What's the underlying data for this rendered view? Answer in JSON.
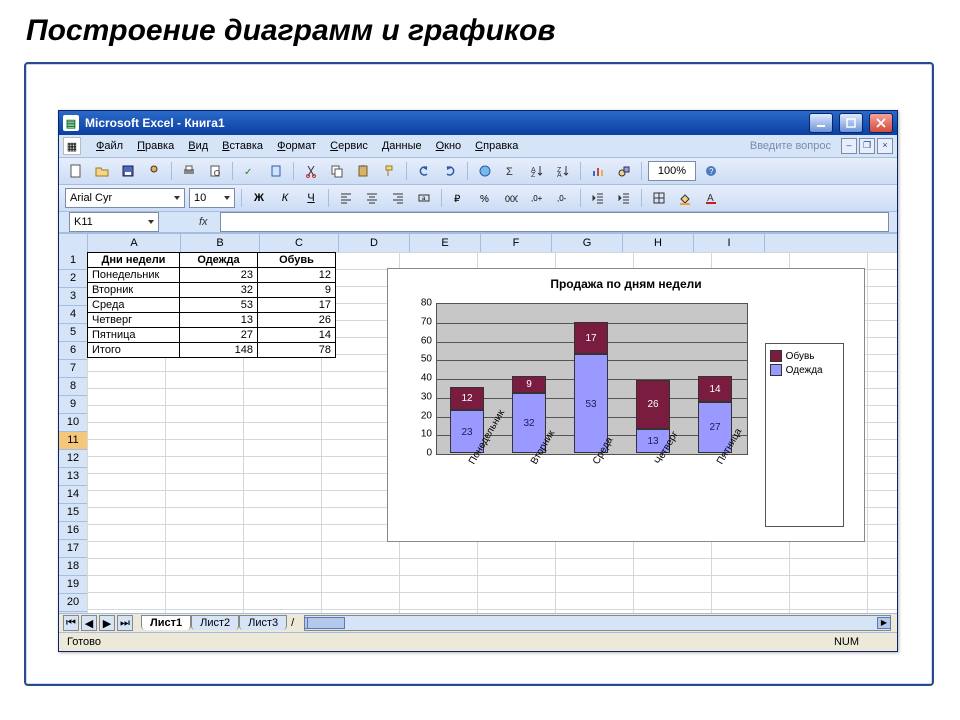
{
  "slide": {
    "title": "Построение диаграмм и графиков"
  },
  "window": {
    "title": "Microsoft Excel - Книга1"
  },
  "menu": {
    "items": [
      "Файл",
      "Правка",
      "Вид",
      "Вставка",
      "Формат",
      "Сервис",
      "Данные",
      "Окно",
      "Справка"
    ],
    "help_placeholder": "Введите вопрос"
  },
  "toolbar": {
    "zoom": "100%"
  },
  "format_bar": {
    "font": "Arial Cyr",
    "font_size": "10"
  },
  "namebox": {
    "cell_ref": "K11",
    "fx": "fx"
  },
  "columns": [
    "A",
    "B",
    "C",
    "D",
    "E",
    "F",
    "G",
    "H",
    "I"
  ],
  "col_widths": {
    "A": 92,
    "B": 78,
    "C": 78,
    "other": 70
  },
  "row_count": 22,
  "selected_row": 11,
  "table": {
    "headers": [
      "Дни недели",
      "Одежда",
      "Обувь"
    ],
    "rows": [
      {
        "label": "Понедельник",
        "clothes": 23,
        "shoes": 12
      },
      {
        "label": "Вторник",
        "clothes": 32,
        "shoes": 9
      },
      {
        "label": "Среда",
        "clothes": 53,
        "shoes": 17
      },
      {
        "label": "Четверг",
        "clothes": 13,
        "shoes": 26
      },
      {
        "label": "Пятница",
        "clothes": 27,
        "shoes": 14
      }
    ],
    "totals": {
      "label": "Итого",
      "clothes": 148,
      "shoes": 78
    }
  },
  "chart_data": {
    "type": "bar",
    "stacked": true,
    "title": "Продажа по дням недели",
    "categories": [
      "Понедельник",
      "Вторник",
      "Среда",
      "Четверг",
      "Пятница"
    ],
    "series": [
      {
        "name": "Одежда",
        "values": [
          23,
          32,
          53,
          13,
          27
        ],
        "color": "#9a99ff"
      },
      {
        "name": "Обувь",
        "values": [
          12,
          9,
          17,
          26,
          14
        ],
        "color": "#7a1c3f"
      }
    ],
    "ylim": [
      0,
      80
    ],
    "ytick": 10,
    "xlabel": "",
    "ylabel": "",
    "legend_position": "right"
  },
  "legend": {
    "shoes": "Обувь",
    "clothes": "Одежда"
  },
  "sheets": {
    "tabs": [
      "Лист1",
      "Лист2",
      "Лист3"
    ],
    "active": 0
  },
  "status": {
    "ready": "Готово",
    "num": "NUM"
  }
}
